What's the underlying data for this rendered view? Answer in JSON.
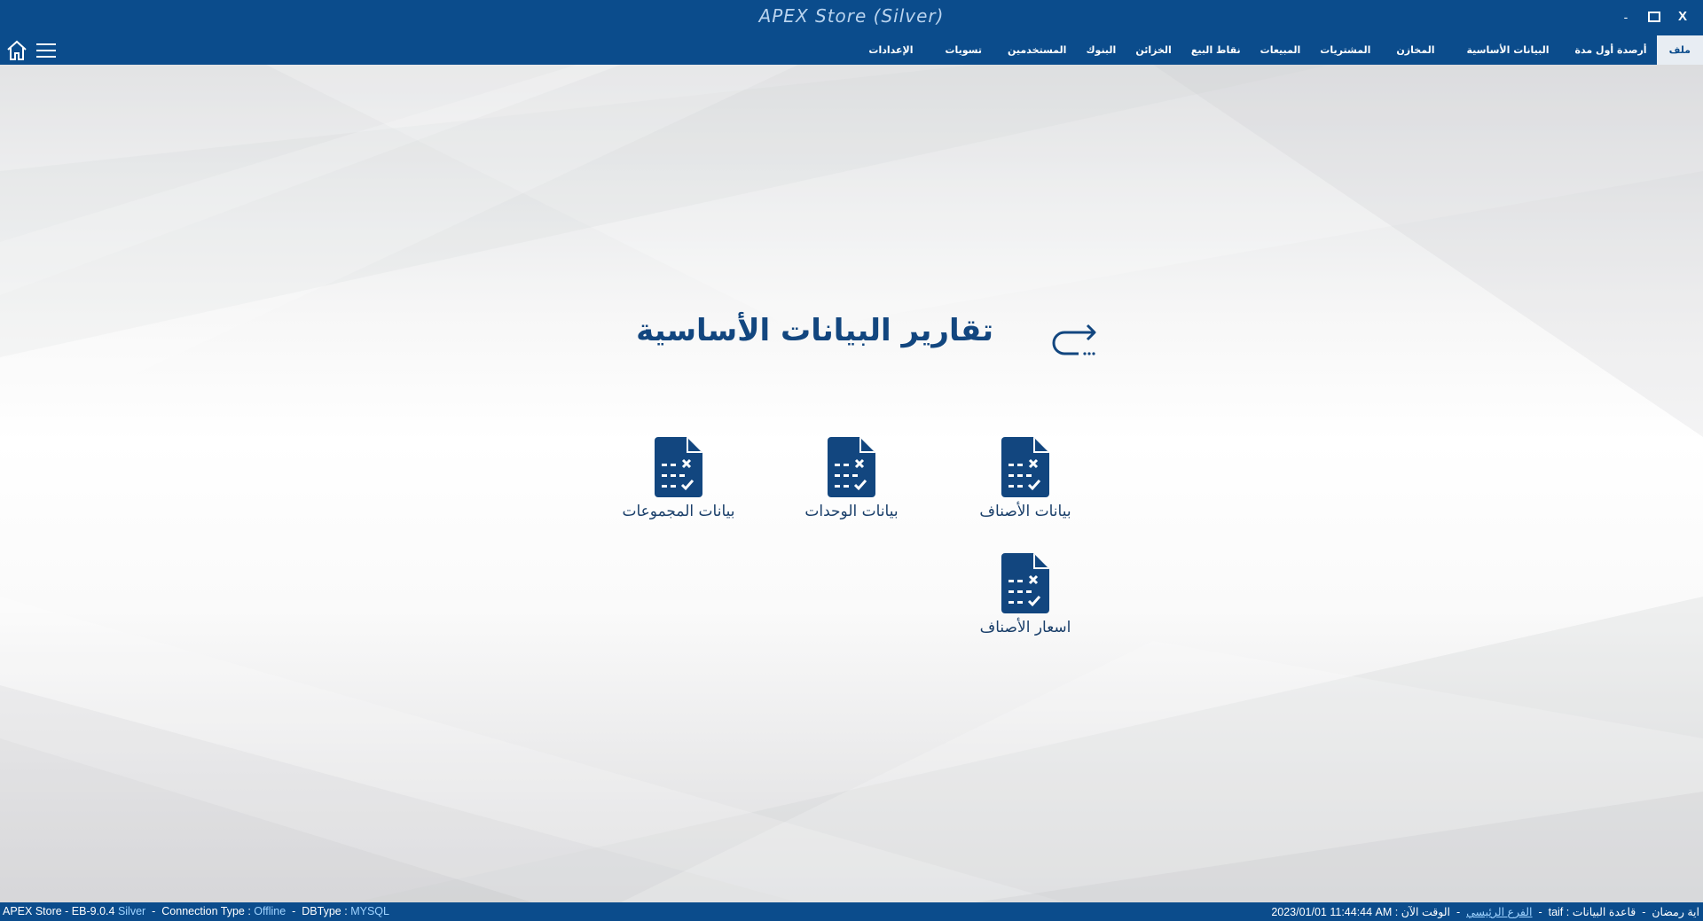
{
  "window": {
    "title": "APEX Store (Silver)",
    "minimize": "-",
    "close": "X"
  },
  "menu": {
    "items": [
      {
        "label": "ملف",
        "active": true
      },
      {
        "label": "أرصدة أول مدة"
      },
      {
        "label": "البيانات الأساسية"
      },
      {
        "label": "المخازن"
      },
      {
        "label": "المشتريات"
      },
      {
        "label": "المبيعات"
      },
      {
        "label": "نقاط البيع"
      },
      {
        "label": "الخزائن"
      },
      {
        "label": "البنوك"
      },
      {
        "label": "المستخدمين"
      },
      {
        "label": "تسويات"
      },
      {
        "label": "الإعدادات"
      }
    ]
  },
  "main": {
    "title": "تقارير البيانات الأساسية",
    "reports": [
      {
        "label": "بيانات الأصناف"
      },
      {
        "label": "بيانات الوحدات"
      },
      {
        "label": "بيانات المجموعات"
      },
      {
        "label": "اسعار الأصناف"
      }
    ]
  },
  "status": {
    "app": "APEX Store - EB-9.0.4",
    "edition": "Silver",
    "conn_label": "Connection Type :",
    "conn_value": "Offline",
    "db_label": "DBType :",
    "db_value": "MYSQL",
    "user": "اية رمضان",
    "db_name_label": "قاعدة البيانات :",
    "db_name": "taif",
    "branch": "الفرع الرئيسي",
    "time_label": "الوقت الآن :",
    "time_value": "2023/01/01 11:44:44 AM"
  },
  "colors": {
    "primary": "#0b4c8c",
    "icon": "#12467f"
  }
}
